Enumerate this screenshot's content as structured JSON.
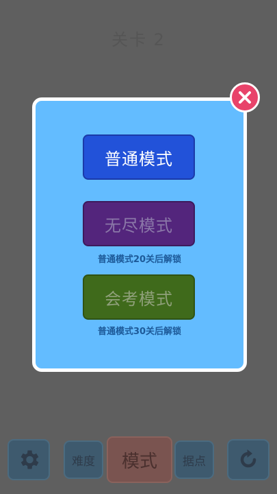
{
  "background": {
    "level_title": "关卡 2",
    "bottom_bar": {
      "difficulty_label": "难度",
      "mode_label": "模式",
      "base_label": "据点"
    }
  },
  "dialog": {
    "modes": [
      {
        "label": "普通模式",
        "locked": false,
        "color": "#2252d9"
      },
      {
        "label": "无尽模式",
        "locked": true,
        "unlock_note": "普通模式20关后解锁",
        "color": "#53257c"
      },
      {
        "label": "会考模式",
        "locked": true,
        "unlock_note": "普通模式30关后解锁",
        "color": "#3f6a1b"
      }
    ],
    "close_icon": "close-icon",
    "colors": {
      "panel": "#63bcff",
      "close": "#e8436a"
    }
  }
}
